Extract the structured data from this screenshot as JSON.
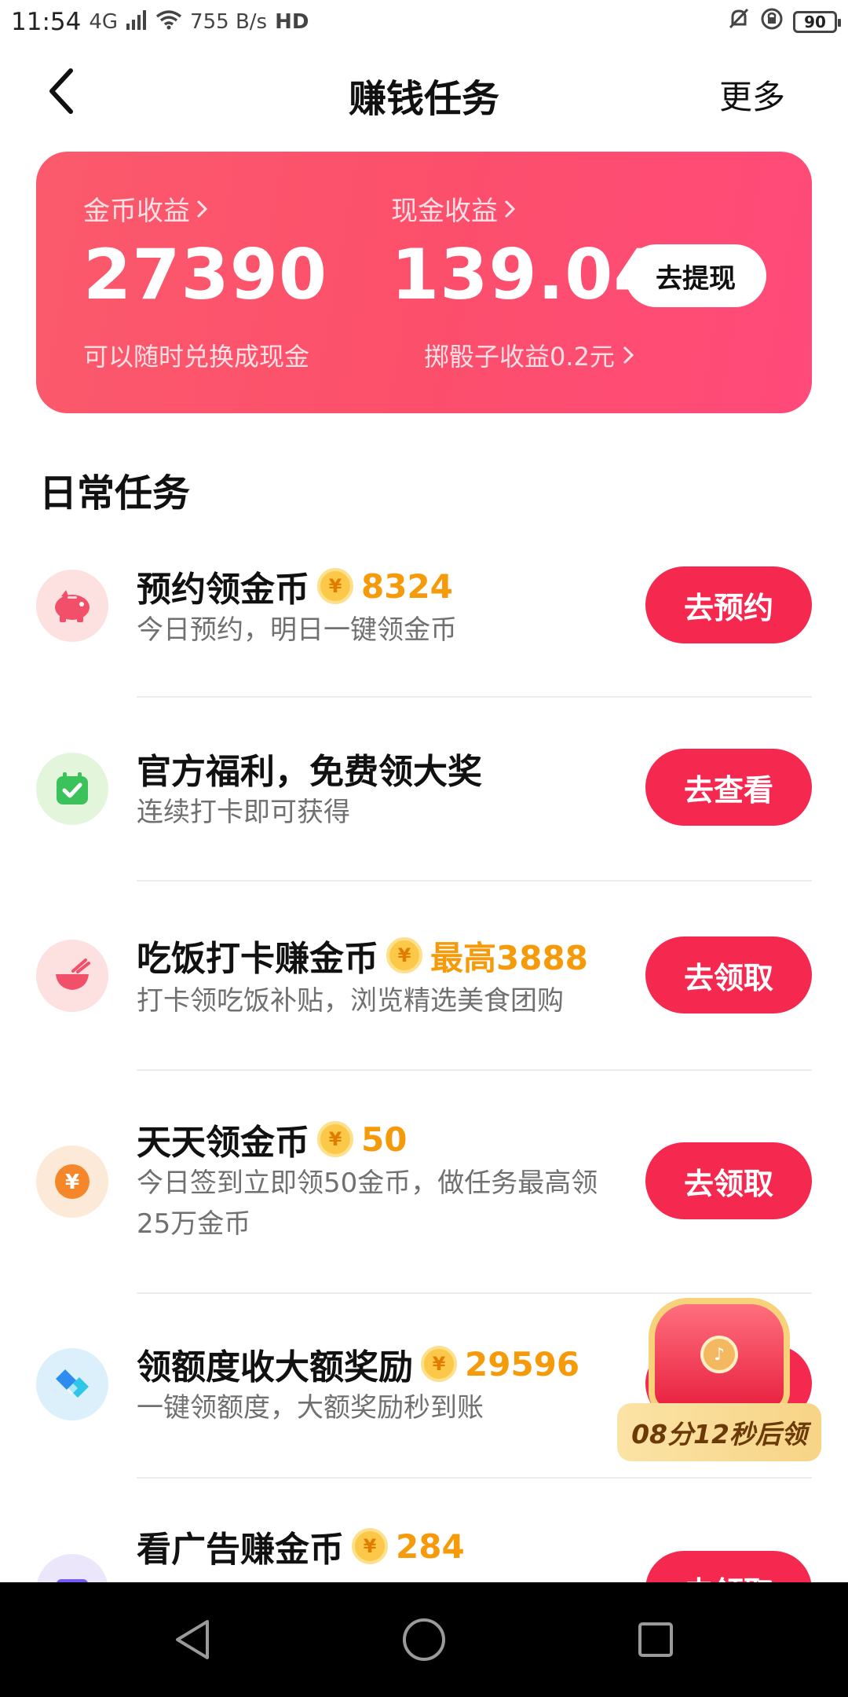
{
  "status_bar": {
    "time": "11:54",
    "network": "4G",
    "speed": "755 B/s",
    "hd": "HD",
    "battery": "90"
  },
  "nav": {
    "title": "赚钱任务",
    "more": "更多"
  },
  "earnings": {
    "coin_label": "金币收益",
    "coin_value": "27390",
    "coin_sub": "可以随时兑换成现金",
    "cash_label": "现金收益",
    "cash_value": "139.04",
    "cash_sub": "掷骰子收益0.2元",
    "withdraw_button": "去提现"
  },
  "section": {
    "title": "日常任务"
  },
  "tasks": [
    {
      "title": "预约领金币",
      "reward": "8324",
      "desc": "今日预约，明日一键领金币",
      "button": "去预约",
      "icon": "piggy-bank-icon",
      "icon_bg": "#fde0e0"
    },
    {
      "title": "官方福利，免费领大奖",
      "reward": "",
      "desc": "连续打卡即可获得",
      "button": "去查看",
      "icon": "calendar-check-icon",
      "icon_bg": "#e3f6dc"
    },
    {
      "title": "吃饭打卡赚金币",
      "reward": "最高3888",
      "desc": "打卡领吃饭补贴，浏览精选美食团购",
      "button": "去领取",
      "icon": "bowl-icon",
      "icon_bg": "#fde0e0"
    },
    {
      "title": "天天领金币",
      "reward": "50",
      "desc": "今日签到立即领50金币，做任务最高领25万金币",
      "button": "去领取",
      "icon": "yuan-coin-icon",
      "icon_bg": "#fde9d8"
    },
    {
      "title": "领额度收大额奖励",
      "reward": "29596",
      "desc": "一键领额度，大额奖励秒到账",
      "button": "",
      "icon": "diamond-icon",
      "icon_bg": "#dcf0fb"
    },
    {
      "title": "看广告赚金币",
      "reward": "284",
      "desc": "",
      "button": "去领取",
      "icon": "ad-icon",
      "icon_bg": "#ece6fb"
    }
  ],
  "treasure": {
    "timer": "08分12秒后领"
  },
  "colors": {
    "accent": "#f5284f",
    "card_gradient_start": "#fb5a6c",
    "card_gradient_end": "#ff4a7a",
    "reward": "#f59b0b"
  }
}
